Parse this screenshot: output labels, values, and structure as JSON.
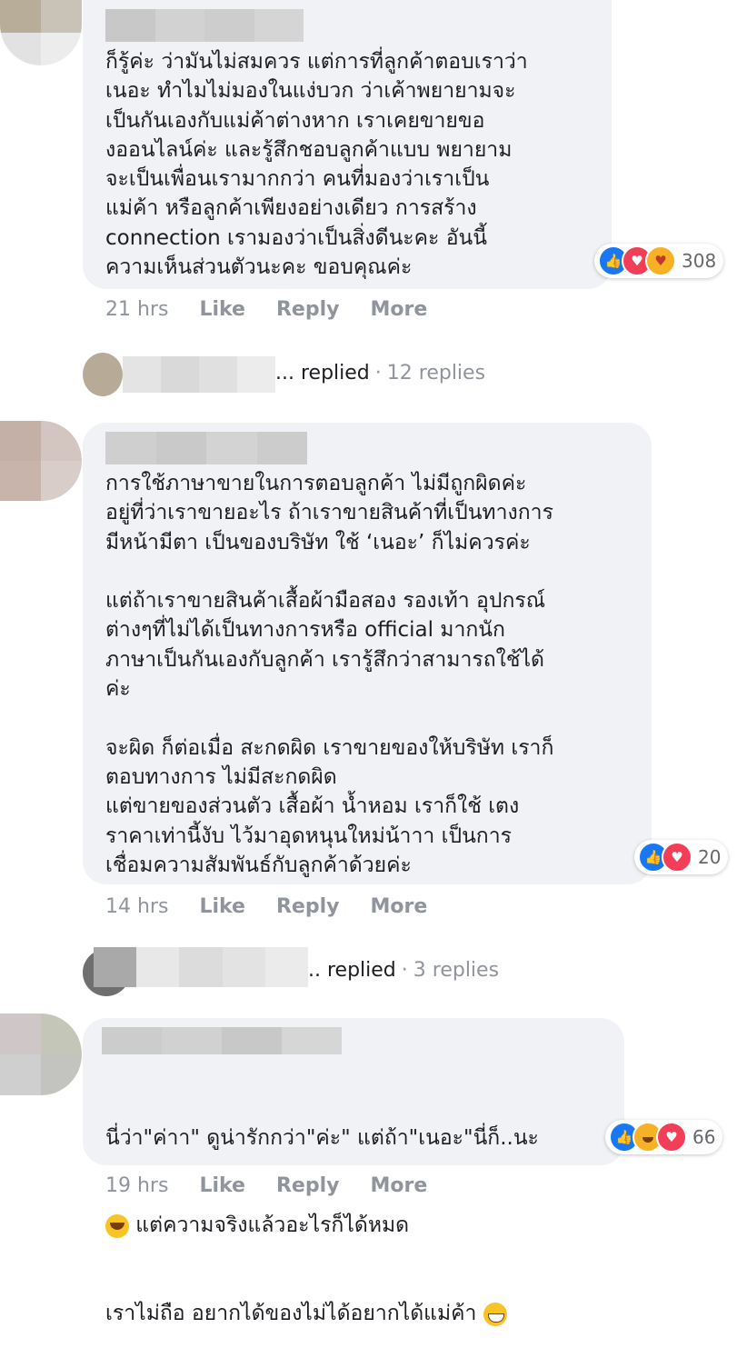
{
  "comments": [
    {
      "text": "ก็รู้ค่ะ ว่ามันไม่สมควร แต่การที่ลูกค้าตอบเราว่า\nเนอะ ทำไมไม่มองในแง่บวก ว่าเค้าพยายามจะ\nเป็นกันเองกับแม่ค้าต่างหาก เราเคยขายขอ\nงออนไลน์ค่ะ และรู้สึกชอบลูกค้าแบบ พยายาม\nจะเป็นเพื่อนเรามากกว่า คนที่มองว่าเราเป็น\nแม่ค้า หรือลูกค้าเพียงอย่างเดียว การสร้าง\nconnection เรามองว่าเป็นสิ่งดีนะคะ อันนี้\nความเห็นส่วนตัวนะคะ ขอบคุณค่ะ",
      "reactions": {
        "icons": [
          "like-icon",
          "love-icon",
          "care-icon"
        ],
        "count": "308"
      },
      "time": "21 hrs",
      "actions": [
        "Like",
        "Reply",
        "More"
      ],
      "replies": {
        "suffix": "... replied",
        "count": "12 replies"
      }
    },
    {
      "text": "การใช้ภาษาขายในการตอบลูกค้า ไม่มีถูกผิดค่ะ\nอยู่ที่ว่าเราขายอะไร ถ้าเราขายสินค้าที่เป็นทางการ\nมีหน้ามีตา เป็นของบริษัท ใช้ ‘เนอะ’ ก็ไม่ควรค่ะ\n\nแต่ถ้าเราขายสินค้าเสื้อผ้ามือสอง รองเท้า อุปกรณ์\nต่างๆที่ไม่ได้เป็นทางการหรือ official มากนัก\nภาษาเป็นกันเองกับลูกค้า เรารู้สึกว่าสามารถใช้ได้\nค่ะ\n\nจะผิด ก็ต่อเมื่อ สะกดผิด เราขายของให้บริษัท เราก็\nตอบทางการ ไม่มีสะกดผิด\nแต่ขายของส่วนตัว เสื้อผ้า น้ำหอม เราก็ใช้ เตง\nราคาเท่านี้งับ ไว้มาอุดหนุนใหม่น้าาา เป็นการ\nเชื่อมความสัมพันธ์กับลูกค้าด้วยค่ะ",
      "reactions": {
        "icons": [
          "like-icon",
          "love-icon"
        ],
        "count": "20"
      },
      "time": "14 hrs",
      "actions": [
        "Like",
        "Reply",
        "More"
      ],
      "replies": {
        "suffix": ".. replied",
        "count": "3 replies"
      }
    },
    {
      "line1": "นี่ว่า\"ค่าา\" ดูน่ารักกว่า\"ค่ะ\" แต่ถ้า\"เนอะ\"นี่ก็..นะ",
      "line2": " แต่ความจริงแล้วอะไรก็ได้หมด",
      "line3": "เราไม่ถือ อยากได้ของไม่ได้อยากได้แม่ค้า ",
      "reactions": {
        "icons": [
          "like-icon",
          "haha-icon",
          "love-icon"
        ],
        "count": "66"
      },
      "time": "19 hrs",
      "actions": [
        "Like",
        "Reply",
        "More"
      ]
    }
  ],
  "colors": {
    "bubble": "#f0f2f5",
    "like": "#1877f2",
    "love": "#f33e58",
    "haha": "#f7b125"
  }
}
